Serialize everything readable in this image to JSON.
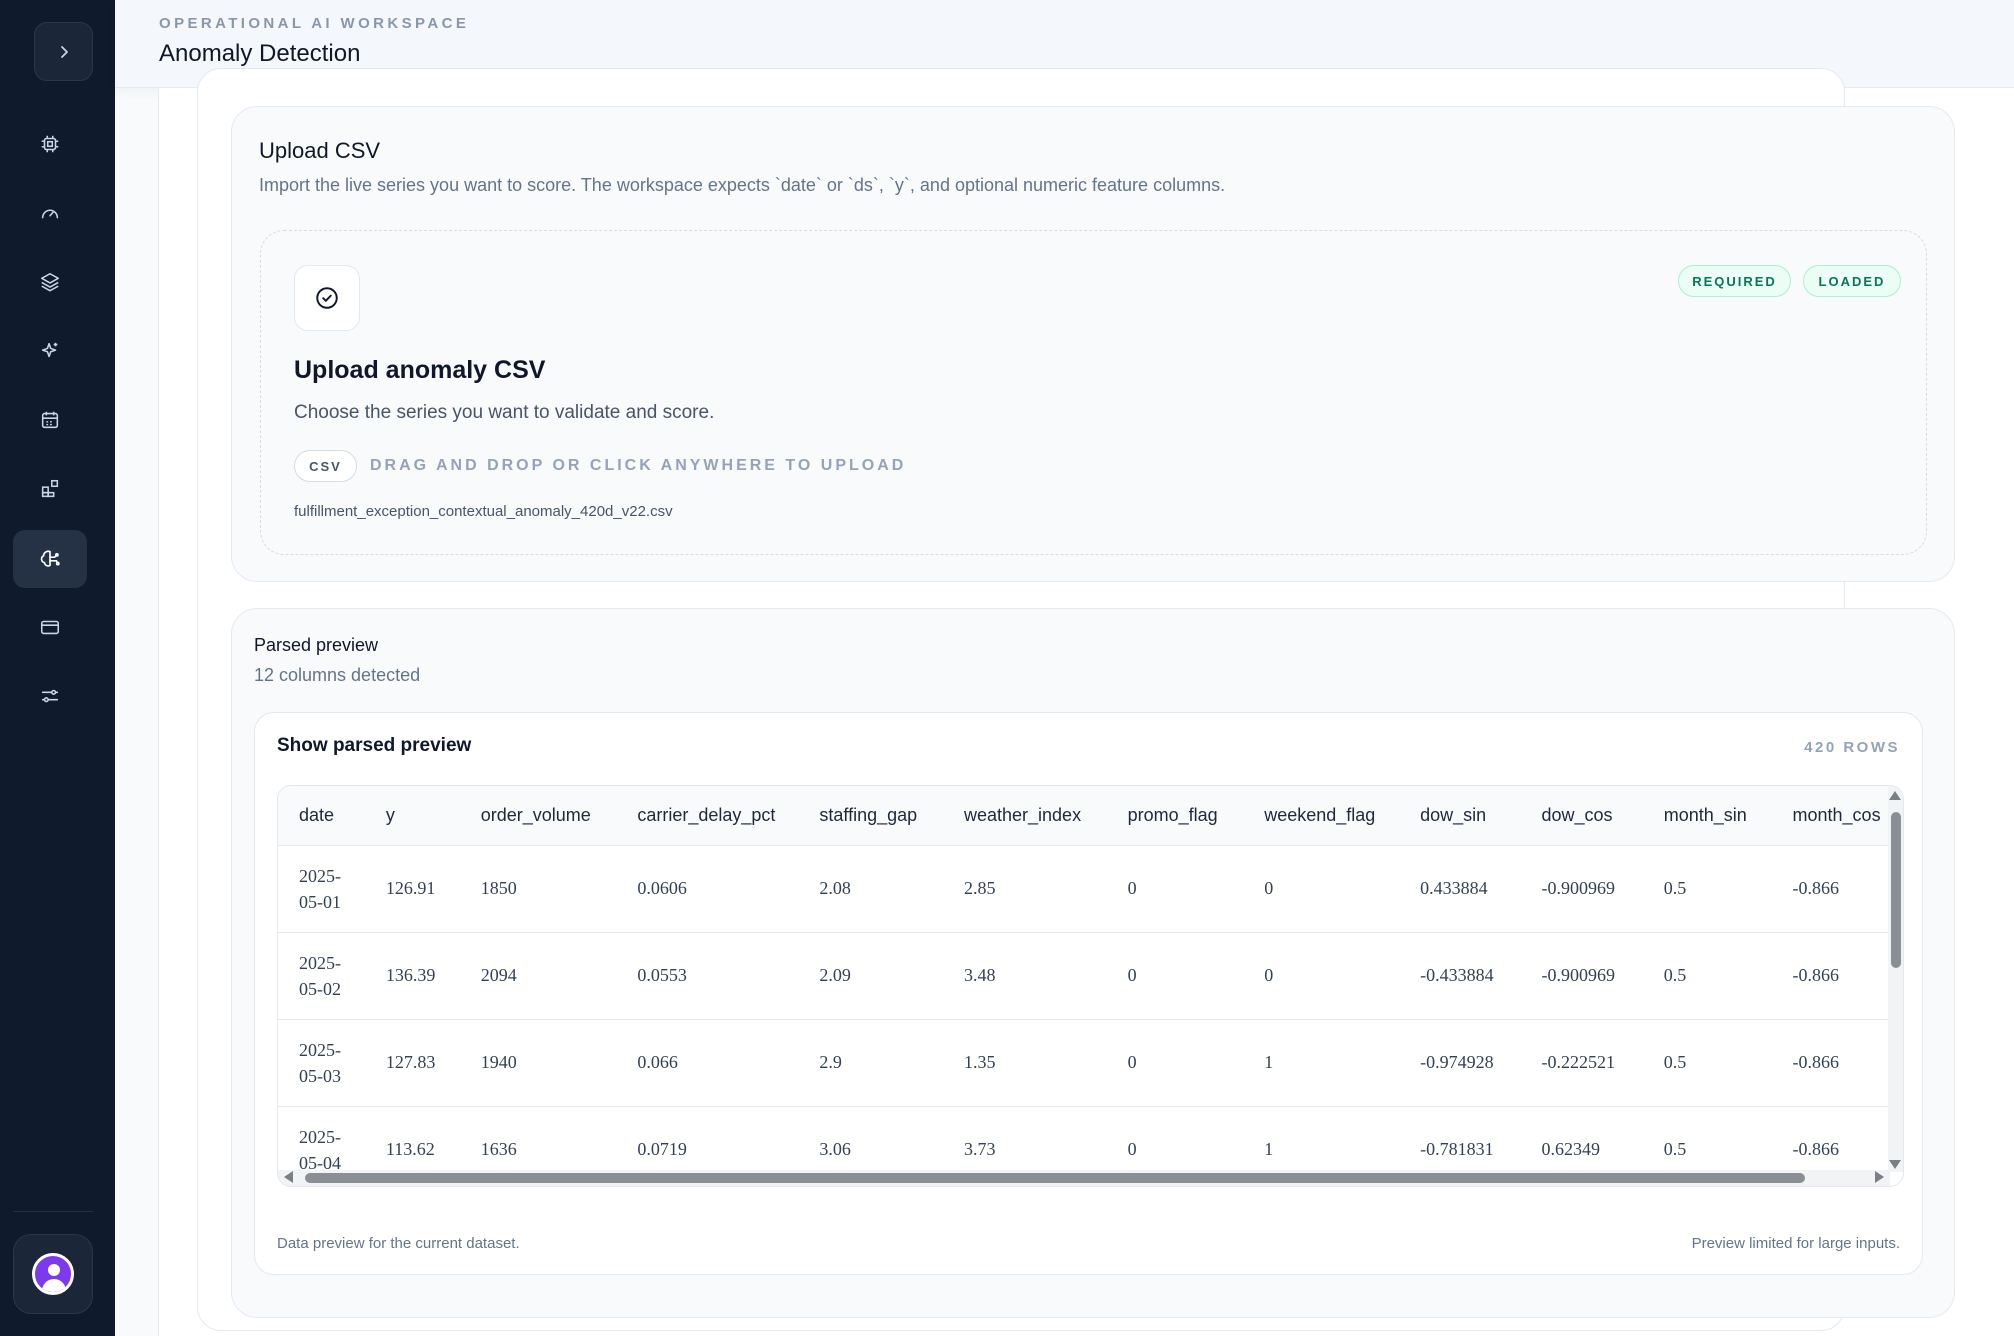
{
  "header": {
    "eyebrow": "OPERATIONAL AI WORKSPACE",
    "title": "Anomaly Detection"
  },
  "sidebar": {
    "items": [
      {
        "icon": "cpu-icon",
        "active": false
      },
      {
        "icon": "gauge-icon",
        "active": false
      },
      {
        "icon": "layers-icon",
        "active": false
      },
      {
        "icon": "sparkles-icon",
        "active": false
      },
      {
        "icon": "calendar-icon",
        "active": false
      },
      {
        "icon": "blocks-icon",
        "active": false
      },
      {
        "icon": "brain-icon",
        "active": true
      },
      {
        "icon": "credit-card-icon",
        "active": false
      },
      {
        "icon": "sliders-icon",
        "active": false
      }
    ]
  },
  "upload": {
    "title": "Upload CSV",
    "description": "Import the live series you want to score. The workspace expects `date` or `ds`, `y`, and optional numeric feature columns.",
    "dropzone": {
      "badges": [
        "REQUIRED",
        "LOADED"
      ],
      "title": "Upload anomaly CSV",
      "description": "Choose the series you want to validate and score.",
      "format_pill": "CSV",
      "hint": "DRAG AND DROP OR CLICK ANYWHERE TO UPLOAD",
      "filename": "fulfillment_exception_contextual_anomaly_420d_v22.csv"
    }
  },
  "preview": {
    "title": "Parsed preview",
    "subtitle": "12 columns detected",
    "card_title": "Show parsed preview",
    "rows_count": "420 ROWS",
    "footer_left": "Data preview for the current dataset.",
    "footer_right": "Preview limited for large inputs.",
    "columns": [
      "date",
      "y",
      "order_volume",
      "carrier_delay_pct",
      "staffing_gap",
      "weather_index",
      "promo_flag",
      "weekend_flag",
      "dow_sin",
      "dow_cos",
      "month_sin",
      "month_cos"
    ],
    "rows": [
      [
        "2025-05-01",
        "126.91",
        "1850",
        "0.0606",
        "2.08",
        "2.85",
        "0",
        "0",
        "0.433884",
        "-0.900969",
        "0.5",
        "-0.866"
      ],
      [
        "2025-05-02",
        "136.39",
        "2094",
        "0.0553",
        "2.09",
        "3.48",
        "0",
        "0",
        "-0.433884",
        "-0.900969",
        "0.5",
        "-0.866"
      ],
      [
        "2025-05-03",
        "127.83",
        "1940",
        "0.066",
        "2.9",
        "1.35",
        "0",
        "1",
        "-0.974928",
        "-0.222521",
        "0.5",
        "-0.866"
      ],
      [
        "2025-05-04",
        "113.62",
        "1636",
        "0.0719",
        "3.06",
        "3.73",
        "0",
        "1",
        "-0.781831",
        "0.62349",
        "0.5",
        "-0.866"
      ]
    ]
  }
}
